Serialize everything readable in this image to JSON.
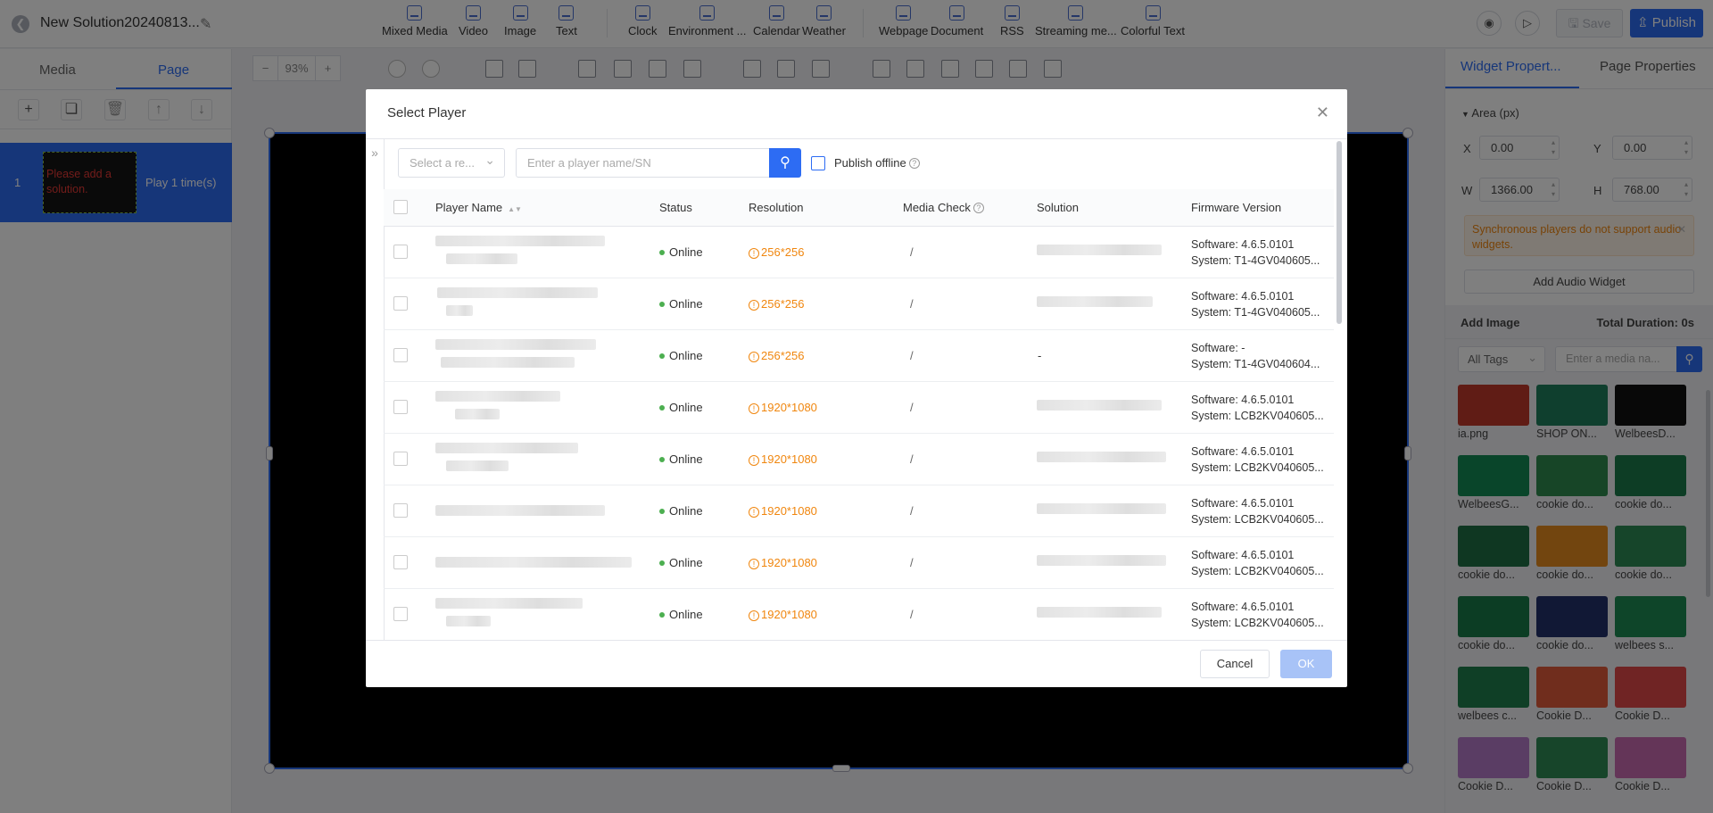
{
  "header": {
    "solution_title": "New Solution20240813...",
    "tools": [
      {
        "label": "Mixed Media",
        "icon": "mixed-media-icon"
      },
      {
        "label": "Video",
        "icon": "video-icon"
      },
      {
        "label": "Image",
        "icon": "image-icon"
      },
      {
        "label": "Text",
        "icon": "text-icon"
      },
      {
        "label": "Clock",
        "icon": "clock-icon"
      },
      {
        "label": "Environment ...",
        "icon": "environment-icon"
      },
      {
        "label": "Calendar",
        "icon": "calendar-icon"
      },
      {
        "label": "Weather",
        "icon": "weather-icon"
      },
      {
        "label": "Webpage",
        "icon": "webpage-icon"
      },
      {
        "label": "Document",
        "icon": "document-icon"
      },
      {
        "label": "RSS",
        "icon": "rss-icon"
      },
      {
        "label": "Streaming me...",
        "icon": "streaming-icon"
      },
      {
        "label": "Colorful Text",
        "icon": "colorful-text-icon"
      }
    ],
    "save_label": "Save",
    "publish_label": "Publish"
  },
  "left_panel": {
    "tabs": [
      "Media",
      "Page"
    ],
    "active_tab": "Page",
    "page_item": {
      "number": "1",
      "thumbnail_text": "Please add a solution.",
      "play_text": "Play 1 time(s)"
    }
  },
  "canvas_toolbar": {
    "zoom": "93%"
  },
  "right_panel": {
    "tabs": [
      "Widget Propert...",
      "Page Properties"
    ],
    "area_label": "Area (px)",
    "x_label": "X",
    "x_value": "0.00",
    "y_label": "Y",
    "y_value": "0.00",
    "w_label": "W",
    "w_value": "1366.00",
    "h_label": "H",
    "h_value": "768.00",
    "warning": "Synchronous players do not support audio widgets.",
    "add_audio_label": "Add Audio Widget",
    "add_image_title": "Add Image",
    "total_duration": "Total Duration: 0s",
    "tag_select": "All Tags",
    "media_search_placeholder": "Enter a media na...",
    "media": [
      {
        "label": "ia.png",
        "color": "#c0392b"
      },
      {
        "label": "SHOP ON...",
        "color": "#1e7f5c"
      },
      {
        "label": "WelbeesD...",
        "color": "#111111"
      },
      {
        "label": "WelbeesG...",
        "color": "#138a55"
      },
      {
        "label": "cookie do...",
        "color": "#2e8b4f"
      },
      {
        "label": "cookie do...",
        "color": "#1a7a4a"
      },
      {
        "label": "cookie do...",
        "color": "#1f6f44"
      },
      {
        "label": "cookie do...",
        "color": "#e58a1f"
      },
      {
        "label": "cookie do...",
        "color": "#2c8a55"
      },
      {
        "label": "cookie do...",
        "color": "#187a48"
      },
      {
        "label": "cookie do...",
        "color": "#23306b"
      },
      {
        "label": "welbees s...",
        "color": "#1d8a52"
      },
      {
        "label": "welbees c...",
        "color": "#1f7f4d"
      },
      {
        "label": "Cookie D...",
        "color": "#e05a3a"
      },
      {
        "label": "Cookie D...",
        "color": "#e04848"
      },
      {
        "label": "Cookie D...",
        "color": "#b57ac8"
      },
      {
        "label": "Cookie D...",
        "color": "#2f8a55"
      },
      {
        "label": "Cookie D...",
        "color": "#c86ab0"
      }
    ]
  },
  "modal": {
    "title": "Select Player",
    "region_placeholder": "Select a re...",
    "search_placeholder": "Enter a player name/SN",
    "publish_offline": "Publish offline",
    "columns": [
      "Player Name",
      "Status",
      "Resolution",
      "Media Check",
      "Solution",
      "Firmware Version"
    ],
    "rows": [
      {
        "status": "Online",
        "resolution": "256*256",
        "media_check": "/",
        "solution": "",
        "software": "Software: 4.6.5.0101",
        "system": "System: T1-4GV040605..."
      },
      {
        "status": "Online",
        "resolution": "256*256",
        "media_check": "/",
        "solution": "",
        "software": "Software: 4.6.5.0101",
        "system": "System: T1-4GV040605..."
      },
      {
        "status": "Online",
        "resolution": "256*256",
        "media_check": "/",
        "solution": "-",
        "software": "Software: -",
        "system": "System: T1-4GV040604..."
      },
      {
        "status": "Online",
        "resolution": "1920*1080",
        "media_check": "/",
        "solution": "",
        "software": "Software: 4.6.5.0101",
        "system": "System: LCB2KV040605..."
      },
      {
        "status": "Online",
        "resolution": "1920*1080",
        "media_check": "/",
        "solution": "",
        "software": "Software: 4.6.5.0101",
        "system": "System: LCB2KV040605..."
      },
      {
        "status": "Online",
        "resolution": "1920*1080",
        "media_check": "/",
        "solution": "",
        "software": "Software: 4.6.5.0101",
        "system": "System: LCB2KV040605..."
      },
      {
        "status": "Online",
        "resolution": "1920*1080",
        "media_check": "/",
        "solution": "",
        "software": "Software: 4.6.5.0101",
        "system": "System: LCB2KV040605..."
      },
      {
        "status": "Online",
        "resolution": "1920*1080",
        "media_check": "/",
        "solution": "",
        "software": "Software: 4.6.5.0101",
        "system": "System: LCB2KV040605..."
      }
    ],
    "cancel_label": "Cancel",
    "ok_label": "OK"
  }
}
